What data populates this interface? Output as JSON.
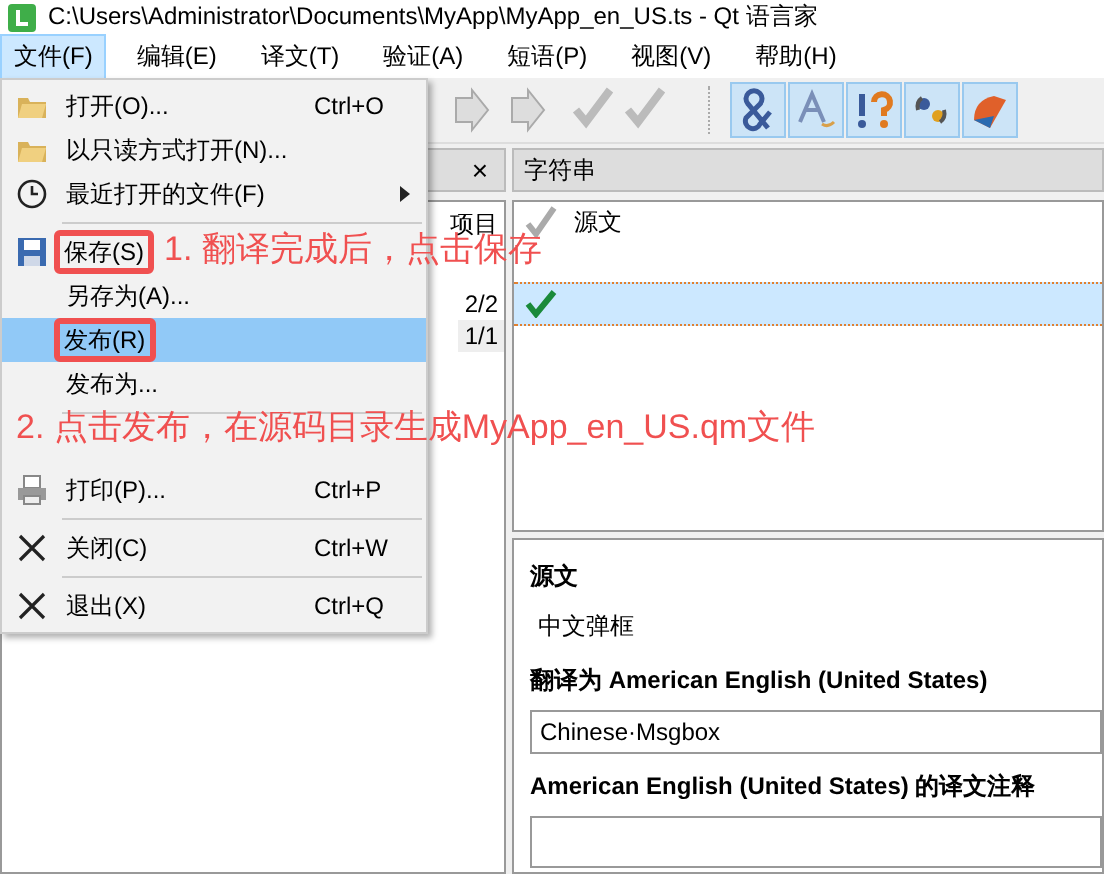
{
  "title_bar": {
    "title": "C:\\Users\\Administrator\\Documents\\MyApp\\MyApp_en_US.ts - Qt 语言家"
  },
  "menu_bar": [
    {
      "label": "文件(F)",
      "selected": true
    },
    {
      "label": "编辑(E)",
      "selected": false
    },
    {
      "label": "译文(T)",
      "selected": false
    },
    {
      "label": "验证(A)",
      "selected": false
    },
    {
      "label": "短语(P)",
      "selected": false
    },
    {
      "label": "视图(V)",
      "selected": false
    },
    {
      "label": "帮助(H)",
      "selected": false
    }
  ],
  "file_menu": [
    {
      "kind": "item",
      "label": "打开(O)...",
      "shortcut": "Ctrl+O",
      "selected": false
    },
    {
      "kind": "item",
      "label": "以只读方式打开(N)...",
      "selected": false
    },
    {
      "kind": "submenu",
      "label": "最近打开的文件(F)",
      "selected": false
    },
    {
      "kind": "separator"
    },
    {
      "kind": "item",
      "label": "保存(S)",
      "selected": false,
      "marked": true
    },
    {
      "kind": "item",
      "label": "另存为(A)...",
      "selected": false
    },
    {
      "kind": "item",
      "label": "发布(R)",
      "selected": true,
      "marked": true
    },
    {
      "kind": "item",
      "label": "发布为...",
      "selected": false
    },
    {
      "kind": "separator"
    },
    {
      "kind": "item",
      "label": "打印(P)...",
      "shortcut": "Ctrl+P",
      "selected": false
    },
    {
      "kind": "separator"
    },
    {
      "kind": "item",
      "label": "关闭(C)",
      "shortcut": "Ctrl+W",
      "selected": false
    },
    {
      "kind": "separator"
    },
    {
      "kind": "item",
      "label": "退出(X)",
      "shortcut": "Ctrl+Q",
      "selected": false
    }
  ],
  "project_panel": {
    "close": "×",
    "column": "项目",
    "rows": [
      "2/2",
      "1/1"
    ]
  },
  "strings_panel": {
    "title": "字符串",
    "column": "源文",
    "rows": [
      {
        "selected": true
      }
    ]
  },
  "editor": {
    "source_label": "源文",
    "source_text": "中文弹框",
    "translation_label": "翻译为 American English (United States)",
    "translation_value": "Chinese·Msgbox",
    "comment_label": "American English (United States) 的译文注释"
  },
  "annotations": [
    {
      "text": "1. 翻译完成后，点击保存"
    },
    {
      "text": "2. 点击发布，在源码目录生成MyApp_en_US.qm文件"
    }
  ]
}
